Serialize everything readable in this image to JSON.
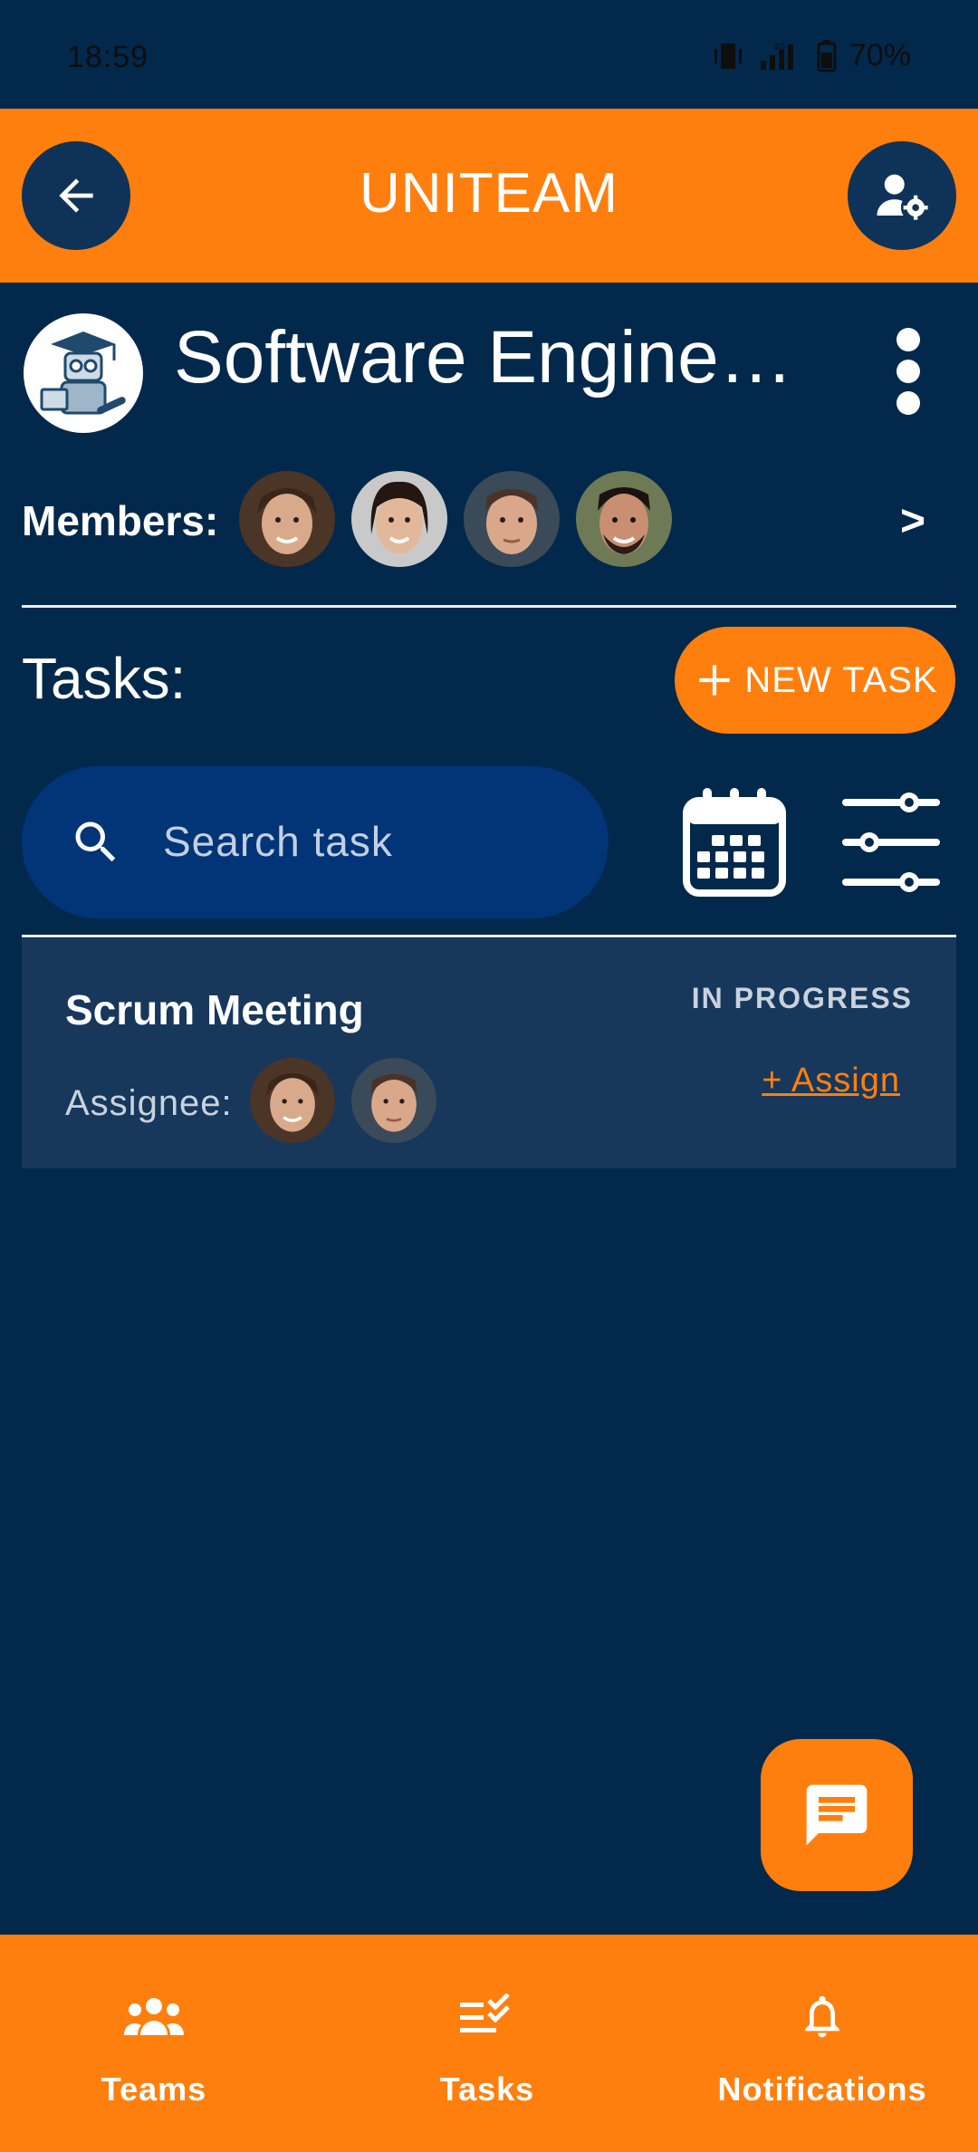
{
  "status_bar": {
    "time": "18:59",
    "battery": "70%"
  },
  "app_bar": {
    "title": "UNITEAM",
    "back_icon": "arrow-left-icon",
    "settings_icon": "user-gear-icon"
  },
  "team": {
    "name": "Software Engine…",
    "logo_icon": "robot-graduate-logo"
  },
  "members": {
    "label": "Members:",
    "more": ">",
    "avatars": [
      "member-1",
      "member-2",
      "member-3",
      "member-4"
    ]
  },
  "tasks": {
    "label": "Tasks:",
    "new_task_label": "NEW TASK",
    "search_placeholder": "Search task",
    "items": [
      {
        "title": "Scrum Meeting",
        "status": "IN PROGRESS",
        "assignee_label": "Assignee:",
        "assign_link": "+ Assign"
      }
    ]
  },
  "bottom_nav": [
    {
      "label": "Teams",
      "icon": "teams-icon"
    },
    {
      "label": "Tasks",
      "icon": "tasks-icon"
    },
    {
      "label": "Notifications",
      "icon": "bell-icon"
    }
  ],
  "colors": {
    "background": "#02294c",
    "accent": "#ff7f0e",
    "card": "#17375b",
    "search": "#013577"
  }
}
